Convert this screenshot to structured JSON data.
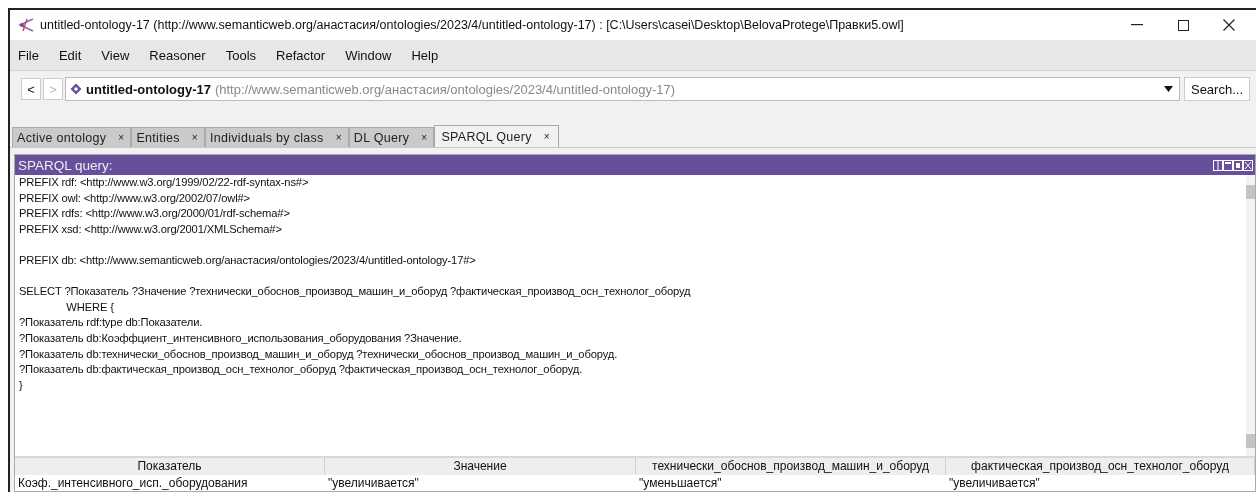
{
  "window": {
    "title": "untitled-ontology-17 (http://www.semanticweb.org/анастасия/ontologies/2023/4/untitled-ontology-17)  : [C:\\Users\\casei\\Desktop\\BelovaProtege\\Правки5.owl]"
  },
  "menu": [
    "File",
    "Edit",
    "View",
    "Reasoner",
    "Tools",
    "Refactor",
    "Window",
    "Help"
  ],
  "nav": {
    "back": {
      "label": "<",
      "disabled": false
    },
    "forward": {
      "label": ">",
      "disabled": true
    },
    "ontology_name": "untitled-ontology-17",
    "ontology_iri": "(http://www.semanticweb.org/анастасия/ontologies/2023/4/untitled-ontology-17)",
    "search_button": "Search..."
  },
  "tabs": [
    {
      "label": "Active ontology",
      "close": "×",
      "selected": false
    },
    {
      "label": "Entities",
      "close": "×",
      "selected": false
    },
    {
      "label": "Individuals by class",
      "close": "×",
      "selected": false
    },
    {
      "label": "DL Query",
      "close": "×",
      "selected": false
    },
    {
      "label": "SPARQL Query",
      "close": "×",
      "selected": true
    }
  ],
  "query_panel": {
    "title": "SPARQL query:",
    "lines": [
      "PREFIX rdf: <http://www.w3.org/1999/02/22-rdf-syntax-ns#>",
      "PREFIX owl: <http://www.w3.org/2002/07/owl#>",
      "PREFIX rdfs: <http://www.w3.org/2000/01/rdf-schema#>",
      "PREFIX xsd: <http://www.w3.org/2001/XMLSchema#>",
      "PREFIX db: <http://www.semanticweb.org/анастасия/ontologies/2023/4/untitled-ontology-17#>",
      "SELECT ?Показатель ?Значение ?технически_обоснов_производ_машин_и_оборуд ?фактическая_производ_осн_технолог_оборуд",
      "                WHERE {",
      "?Показатель rdf:type db:Показатели.",
      "?Показатель db:Коэффциент_интенсивного_использования_оборудования ?Значение.",
      "?Показатель db:технически_обоснов_производ_машин_и_оборуд ?технически_обоснов_производ_машин_и_оборуд.",
      "?Показатель db:фактическая_производ_осн_технолог_оборуд ?фактическая_производ_осн_технолог_оборуд.",
      "}"
    ]
  },
  "results": {
    "columns": [
      "Показатель",
      "Значение",
      "технически_обоснов_производ_машин_и_оборуд",
      "фактическая_производ_осн_технолог_оборуд"
    ],
    "rows": [
      [
        "Коэф._интенсивного_исп._оборудования",
        "\"увеличивается\"",
        "\"уменьшается\"",
        "\"увеличивается\""
      ]
    ]
  }
}
